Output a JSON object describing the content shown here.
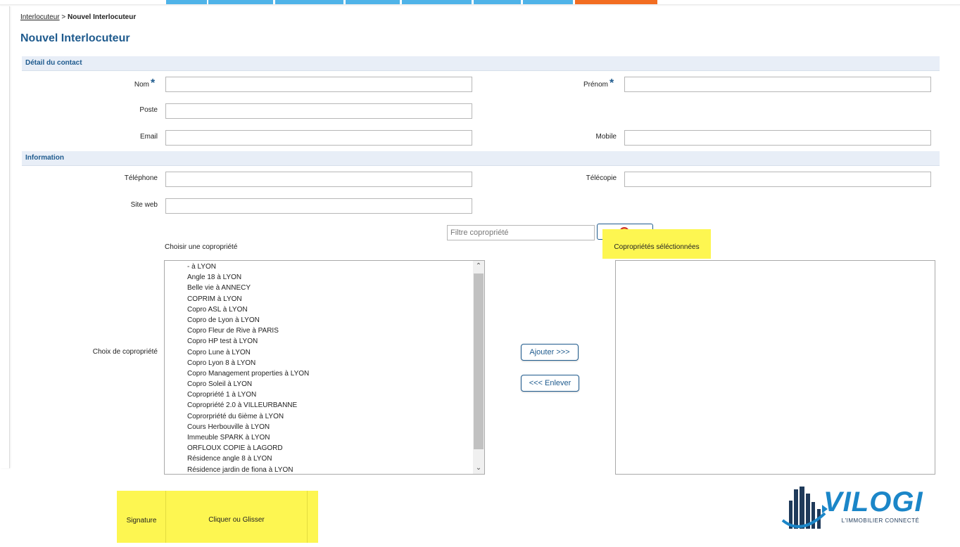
{
  "breadcrumb": {
    "parent": "Interlocuteur",
    "separator": ">",
    "current": "Nouvel Interlocuteur"
  },
  "page_title": "Nouvel Interlocuteur",
  "sections": {
    "contact": "Détail du contact",
    "information": "Information"
  },
  "fields": {
    "nom": {
      "label": "Nom",
      "value": ""
    },
    "prenom": {
      "label": "Prénom",
      "value": ""
    },
    "poste": {
      "label": "Poste",
      "value": ""
    },
    "email": {
      "label": "Email",
      "value": ""
    },
    "mobile": {
      "label": "Mobile",
      "value": ""
    },
    "telephone": {
      "label": "Téléphone",
      "value": ""
    },
    "telecopie": {
      "label": "Télécopie",
      "value": ""
    },
    "site_web": {
      "label": "Site web",
      "value": ""
    }
  },
  "required_mark": "*",
  "filter": {
    "placeholder": "Filtre copropriété"
  },
  "choose_label": "Choisir une copropriété",
  "selected_label": "Copropriétés séléctionnées",
  "choice_label": "Choix de copropriété",
  "coproprietes": [
    "- à LYON",
    "Angle 18 à LYON",
    "Belle vie à ANNECY",
    "COPRIM à LYON",
    "Copro ASL à LYON",
    "Copro de Lyon à LYON",
    "Copro Fleur de Rive à PARIS",
    "Copro HP test à LYON",
    "Copro Lune à LYON",
    "Copro Lyon 8 à LYON",
    "Copro Management properties à LYON",
    "Copro Soleil à LYON",
    "Copropriété 1 à LYON",
    "Copropriété 2.0 à VILLEURBANNE",
    "Coprorpriété du 6ième à LYON",
    "Cours Herbouville à LYON",
    "Immeuble SPARK à LYON",
    "ORFLOUX COPIE à LAGORD",
    "Résidence angle 8 à LYON",
    "Résidence jardin de fiona à LYON"
  ],
  "buttons": {
    "add": "Ajouter >>>",
    "remove": "<<< Enlever"
  },
  "signature": {
    "label": "Signature",
    "drop": "Cliquer ou Glisser"
  },
  "logo": {
    "name": "VILOGI",
    "tagline": "L'IMMOBILIER CONNECTÉ"
  },
  "colors": {
    "accent": "#1f5b8e",
    "nav_tab": "#4fb3e8",
    "nav_active": "#f26d21",
    "highlight": "#fdf651"
  }
}
